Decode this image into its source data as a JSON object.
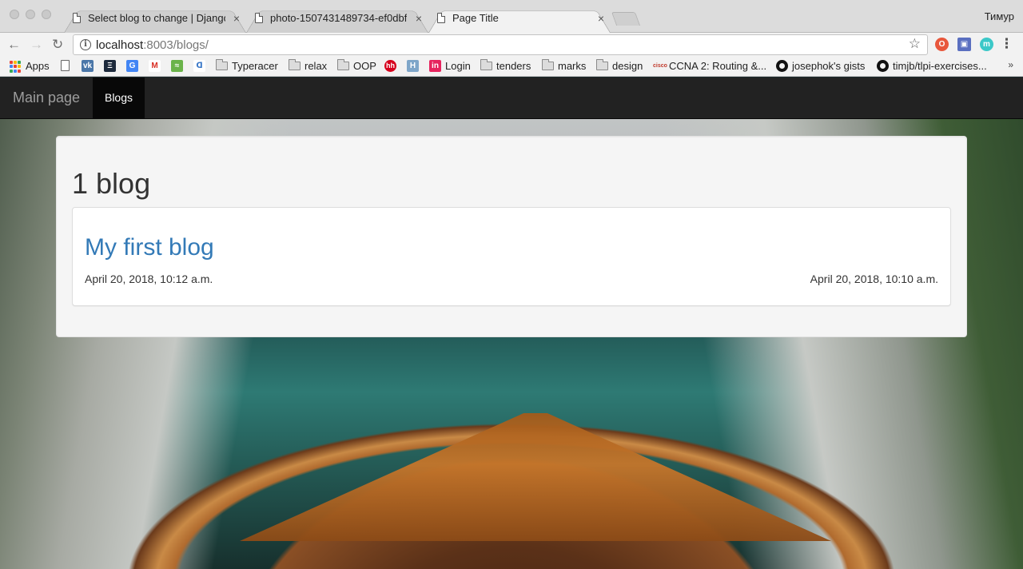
{
  "browser": {
    "tabs": [
      {
        "label": "Select blog to change | Django",
        "active": false
      },
      {
        "label": "photo-1507431489734-ef0dbf",
        "active": false
      },
      {
        "label": "Page Title",
        "active": true
      }
    ],
    "profile_name": "Тимур",
    "url_host": "localhost",
    "url_rest": ":8003/blogs/"
  },
  "bookmarks": [
    {
      "label": "Apps",
      "icon": "apps-grid-icon"
    },
    {
      "label": "",
      "icon": "page-icon"
    },
    {
      "label": "",
      "icon": "vk-icon"
    },
    {
      "label": "",
      "icon": "e-icon"
    },
    {
      "label": "",
      "icon": "translate-icon"
    },
    {
      "label": "",
      "icon": "gmail-icon"
    },
    {
      "label": "",
      "icon": "green-icon"
    },
    {
      "label": "",
      "icon": "swirl-icon"
    },
    {
      "label": "Typeracer",
      "icon": "folder-icon"
    },
    {
      "label": "relax",
      "icon": "folder-icon"
    },
    {
      "label": "OOP",
      "icon": "folder-icon"
    },
    {
      "label": "",
      "icon": "hh-icon"
    },
    {
      "label": "",
      "icon": "h-icon"
    },
    {
      "label": "Login",
      "icon": "invision-icon"
    },
    {
      "label": "tenders",
      "icon": "folder-icon"
    },
    {
      "label": "marks",
      "icon": "folder-icon"
    },
    {
      "label": "design",
      "icon": "folder-icon"
    },
    {
      "label": "CCNA 2: Routing &...",
      "icon": "cisco-icon"
    },
    {
      "label": "josephok's gists",
      "icon": "github-icon"
    },
    {
      "label": "timjb/tlpi-exercises...",
      "icon": "github-icon"
    }
  ],
  "navbar": {
    "brand": "Main page",
    "active_item": "Blogs"
  },
  "main": {
    "heading": "1 blog",
    "blogs": [
      {
        "title": "My first blog",
        "date_left": "April 20, 2018, 10:12 a.m.",
        "date_right": "April 20, 2018, 10:10 a.m."
      }
    ]
  },
  "colors": {
    "navbar_bg": "#222222",
    "link_blue": "#337ab7",
    "panel_bg": "#f5f5f5"
  }
}
